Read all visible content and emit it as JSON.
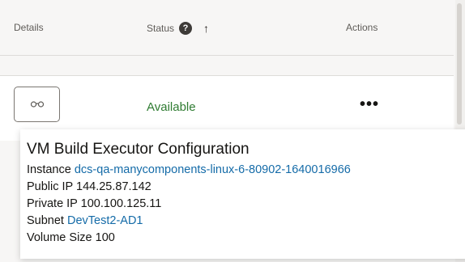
{
  "table": {
    "headers": {
      "details": "Details",
      "status": "Status",
      "actions": "Actions"
    },
    "sort_indicator": "ascending",
    "row": {
      "status": "Available",
      "actions_label": "•••",
      "details_icon": "glasses-icon"
    }
  },
  "popup": {
    "title": "VM Build Executor Configuration",
    "instance_label": "Instance",
    "instance_value": "dcs-qa-manycomponents-linux-6-80902-1640016966",
    "public_ip_label": "Public IP",
    "public_ip_value": "144.25.87.142",
    "private_ip_label": "Private IP",
    "private_ip_value": "100.100.125.11",
    "subnet_label": "Subnet",
    "subnet_value": "DevTest2-AD1",
    "volume_label": "Volume Size",
    "volume_value": "100"
  },
  "colors": {
    "status_available": "#2f7c32",
    "link": "#146ba8"
  }
}
